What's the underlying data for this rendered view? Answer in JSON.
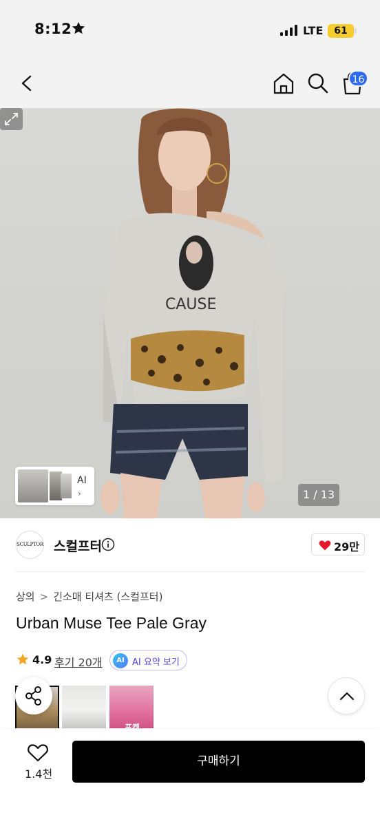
{
  "status_bar": {
    "time": "8:12",
    "network": "LTE",
    "battery": "61"
  },
  "header": {
    "cart_count": "16"
  },
  "gallery": {
    "ai_label": "AI",
    "ai_chevron": "›",
    "counter": "1 / 13",
    "print_text": "CAUSE"
  },
  "brand": {
    "logo_text": "SCULPTOR",
    "name": "스컬프터",
    "likes": "29만"
  },
  "breadcrumb": {
    "category": "상의",
    "separator": ">",
    "subcategory": "긴소매 티셔츠 (스컬프터)"
  },
  "product": {
    "title": "Urban Muse Tee Pale Gray",
    "rating": "4.9",
    "reviews": "후기 20개",
    "ai_badge": "AI",
    "ai_summary": "AI 요약 보기"
  },
  "swatches": {
    "third_caption": "포켓"
  },
  "bottom_bar": {
    "wish_count": "1.4천",
    "buy_label": "구매하기"
  },
  "colors": {
    "accent_blue": "#2f6bf0",
    "heart_red": "#e8162d",
    "rating_star": "#f5a623",
    "ai_purple": "#5a3fd8",
    "buy_button": "#000000"
  },
  "icons": [
    "star-icon",
    "signal-icon",
    "back-icon",
    "home-icon",
    "search-icon",
    "bag-icon",
    "expand-icon",
    "info-icon",
    "heart-icon",
    "share-icon",
    "chevron-up-icon",
    "heart-outline-icon"
  ]
}
